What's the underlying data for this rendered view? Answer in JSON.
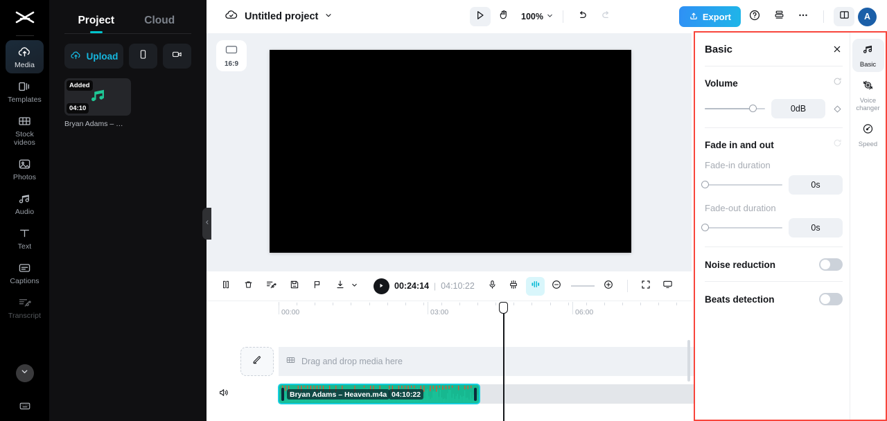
{
  "app": {
    "logo_icon": "capcut-logo-icon",
    "accent": "#00c4cc",
    "export_accent": "#2f90f5",
    "highlight_border": "#f8453b"
  },
  "sidebar": {
    "items": [
      {
        "label": "Media",
        "icon": "cloud-upload-icon",
        "active": true
      },
      {
        "label": "Templates",
        "icon": "templates-icon",
        "active": false
      },
      {
        "label": "Stock videos",
        "icon": "film-strip-icon",
        "active": false
      },
      {
        "label": "Photos",
        "icon": "image-icon",
        "active": false
      },
      {
        "label": "Audio",
        "icon": "music-note-icon",
        "active": false
      },
      {
        "label": "Text",
        "icon": "text-t-icon",
        "active": false
      },
      {
        "label": "Captions",
        "icon": "captions-icon",
        "active": false
      },
      {
        "label": "Transcript",
        "icon": "transcript-scissors-icon",
        "active": false
      }
    ],
    "collapse_icon": "chevron-down-icon",
    "keyboard_icon": "keyboard-icon"
  },
  "media_panel": {
    "tabs": [
      {
        "label": "Project",
        "active": true
      },
      {
        "label": "Cloud",
        "active": false
      }
    ],
    "upload_label": "Upload",
    "upload_icon": "cloud-upload-icon",
    "device_icon": "phone-icon",
    "record_icon": "camera-record-icon",
    "collapse_handle_icon": "chevron-left-icon",
    "assets": [
      {
        "badge": "Added",
        "duration": "04:10",
        "name": "Bryan Adams – …",
        "icon": "music-note-icon"
      }
    ]
  },
  "topbar": {
    "cloud_icon": "cloud-check-icon",
    "project_title": "Untitled project",
    "title_caret_icon": "chevron-down-icon",
    "select_tool_icon": "cursor-arrow-icon",
    "hand_tool_icon": "hand-icon",
    "zoom_level": "100%",
    "zoom_caret_icon": "chevron-down-icon",
    "undo_icon": "undo-icon",
    "redo_icon": "redo-icon",
    "export_label": "Export",
    "export_icon": "upload-share-icon",
    "help_icon": "question-circle-icon",
    "layers_icon": "stack-layers-icon",
    "more_icon": "ellipsis-icon",
    "layout_icon": "panel-layout-icon",
    "avatar_initial": "A"
  },
  "preview": {
    "ratio_label": "16:9",
    "ratio_icon": "aspect-ratio-icon"
  },
  "timeline_toolbar": {
    "split_icon": "split-clip-icon",
    "delete_icon": "trash-icon",
    "auto_cut_icon": "ai-cut-icon",
    "freeze_icon": "freeze-frame-icon",
    "marker_icon": "flag-marker-icon",
    "download_icon": "download-icon",
    "download_caret_icon": "chevron-down-icon",
    "play_icon": "play-icon",
    "current_time": "00:24:14",
    "separator": "|",
    "total_duration": "04:10:22",
    "mic_icon": "microphone-icon",
    "keyframe_icon": "auto-keyframe-icon",
    "mixer_icon": "audio-mixer-icon",
    "zoom_out_icon": "minus-circle-icon",
    "zoom_in_icon": "plus-circle-icon",
    "fit_icon": "fit-to-screen-icon",
    "preview_icon": "monitor-preview-icon"
  },
  "timeline": {
    "ruler_labels": [
      "00:00",
      "03:00",
      "06:00"
    ],
    "playhead_position": "00:24:14",
    "video_track": {
      "edit_icon": "pencil-edit-icon",
      "media_icon": "film-strip-icon",
      "placeholder": "Drag and drop media here"
    },
    "audio_track": {
      "speaker_icon": "speaker-wave-icon",
      "clip_name": "Bryan Adams – Heaven.m4a",
      "clip_duration": "04:10:22",
      "clip_color": "#17b890",
      "selection_color": "#16cfe0",
      "waveform_peak_color": "#e8502d"
    }
  },
  "properties": {
    "title": "Basic",
    "close_icon": "close-icon",
    "reset_icon": "reset-circular-arrow-icon",
    "volume": {
      "label": "Volume",
      "value": "0dB",
      "slider_percent": 80,
      "keyframe_icon": "diamond-keyframe-icon"
    },
    "fade": {
      "label": "Fade in and out",
      "fade_in_label": "Fade-in duration",
      "fade_in_value": "0s",
      "fade_in_percent": 0,
      "fade_out_label": "Fade-out duration",
      "fade_out_value": "0s",
      "fade_out_percent": 0
    },
    "noise_reduction": {
      "label": "Noise reduction",
      "enabled": false
    },
    "beats_detection": {
      "label": "Beats detection",
      "enabled": false
    },
    "tabs": [
      {
        "label": "Basic",
        "icon": "music-note-icon",
        "active": true
      },
      {
        "label": "Voice changer",
        "icon": "voice-changer-icon",
        "active": false
      },
      {
        "label": "Speed",
        "icon": "speedometer-icon",
        "active": false
      }
    ]
  }
}
